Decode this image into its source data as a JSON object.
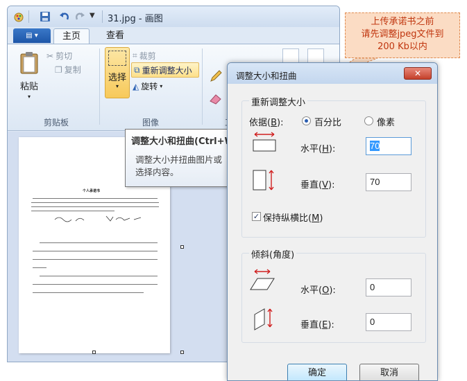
{
  "window": {
    "title": "31.jpg - 画图",
    "tabs": [
      "主页",
      "查看"
    ]
  },
  "ribbon": {
    "clipboard": {
      "paste": "粘贴",
      "cut": "剪切",
      "copy": "复制",
      "group": "剪贴板"
    },
    "image": {
      "select": "选择",
      "crop": "裁剪",
      "resize": "重新调整大小",
      "rotate": "旋转",
      "group": "图像"
    },
    "tools_group_partial": "工"
  },
  "tooltip": {
    "title": "调整大小和扭曲(Ctrl+W)",
    "body": "调整大小并扭曲图片或选择内容。"
  },
  "callout": {
    "line1": "上传承诺书之前",
    "line2": "请先调整jpeg文件到",
    "line3": "200 Kb以内"
  },
  "dialog": {
    "title": "调整大小和扭曲",
    "close": "✕",
    "resize_group": {
      "label": "重新调整大小",
      "by_label": "依据",
      "by_key": "B",
      "percent": "百分比",
      "pixels": "像素",
      "selected": "percent",
      "horizontal_label": "水平",
      "horizontal_key": "H",
      "horizontal_value": "70",
      "vertical_label": "垂直",
      "vertical_key": "V",
      "vertical_value": "70",
      "keep_aspect_label": "保持纵横比",
      "keep_aspect_key": "M",
      "keep_aspect_checked": true
    },
    "skew_group": {
      "label": "倾斜(角度)",
      "horizontal_label": "水平",
      "horizontal_key": "O",
      "horizontal_value": "0",
      "vertical_label": "垂直",
      "vertical_key": "E",
      "vertical_value": "0"
    },
    "ok": "确定",
    "cancel": "取消"
  },
  "document_preview": {
    "heading": "个人承诺书"
  },
  "colors": {
    "accent_red": "#c0360f",
    "callout_bg": "#fbdcc4",
    "selection_blue": "#3399ff",
    "ribbon_highlight": "#fde08a"
  }
}
